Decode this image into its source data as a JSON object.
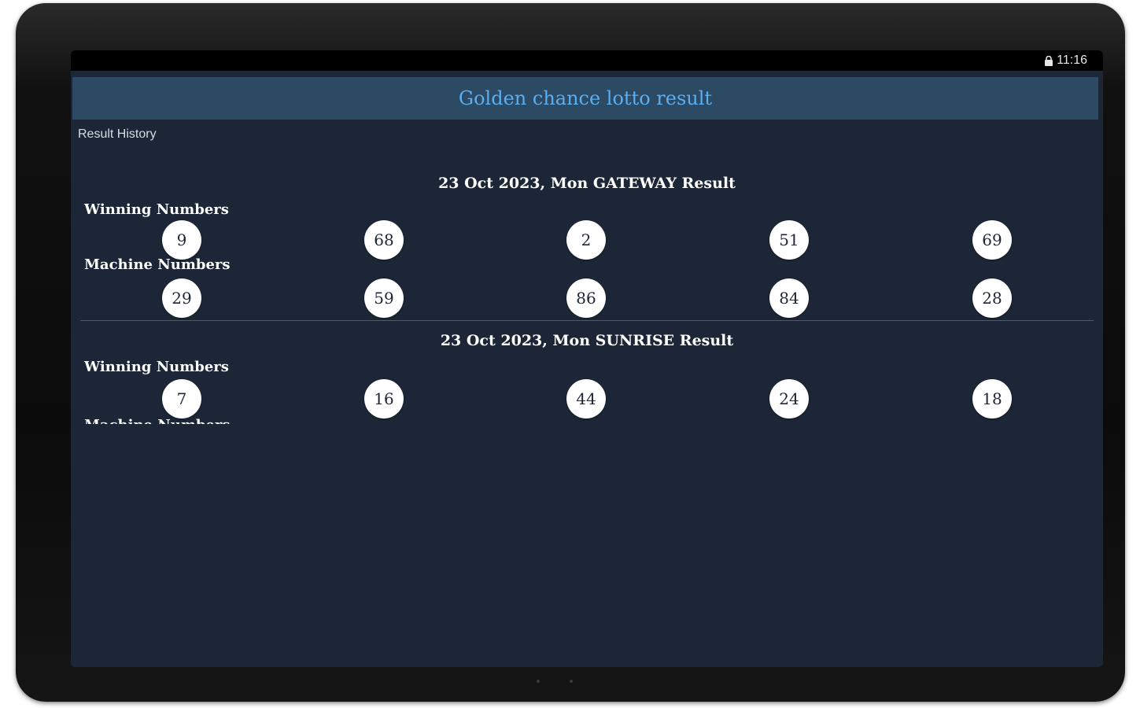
{
  "status_bar": {
    "time": "11:16",
    "icons": [
      "lock-icon"
    ]
  },
  "app_bar": {
    "title": "Golden chance lotto result"
  },
  "section_label": "Result History",
  "results": [
    {
      "title": "23 Oct 2023, Mon GATEWAY Result",
      "winning_label": "Winning Numbers",
      "winning_numbers": [
        "9",
        "68",
        "2",
        "51",
        "69"
      ],
      "machine_label": "Machine Numbers",
      "machine_numbers": [
        "29",
        "59",
        "86",
        "84",
        "28"
      ]
    },
    {
      "title": "23 Oct 2023, Mon SUNRISE Result",
      "winning_label": "Winning Numbers",
      "winning_numbers": [
        "7",
        "16",
        "44",
        "24",
        "18"
      ],
      "machine_label": "Machine Numbers"
    }
  ],
  "colors": {
    "background": "#1c2637",
    "app_bar": "#2c4a63",
    "title_text": "#5aaef2",
    "divider": "#2f6e55",
    "ball": "#ffffff"
  }
}
